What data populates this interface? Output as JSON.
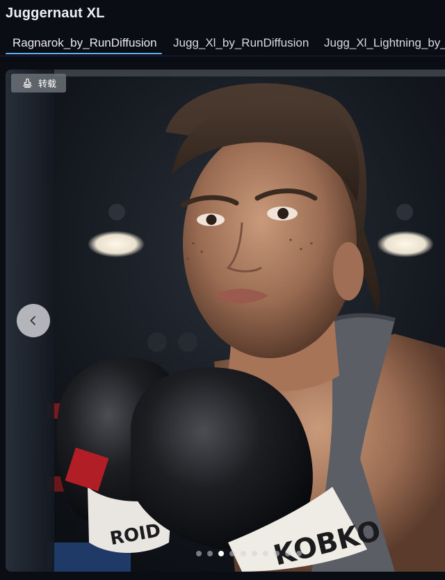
{
  "page": {
    "title": "Juggernaut XL"
  },
  "tabs": [
    {
      "label": "Ragnarok_by_RunDiffusion",
      "active": true
    },
    {
      "label": "Jugg_Xl_by_RunDiffusion",
      "active": false
    },
    {
      "label": "Jugg_Xl_Lightning_by_RunDiffusion",
      "active": false
    }
  ],
  "viewer": {
    "badge_label": "转载",
    "badge_icon": "repost-icon",
    "prev_icon": "chevron-left-icon",
    "slide_count": 10,
    "active_slide": 3,
    "image_alt": "Boxer in black gloves, gray tank top, in a boxing ring"
  },
  "colors": {
    "accent": "#59b0f5",
    "background": "#0b0d14"
  }
}
